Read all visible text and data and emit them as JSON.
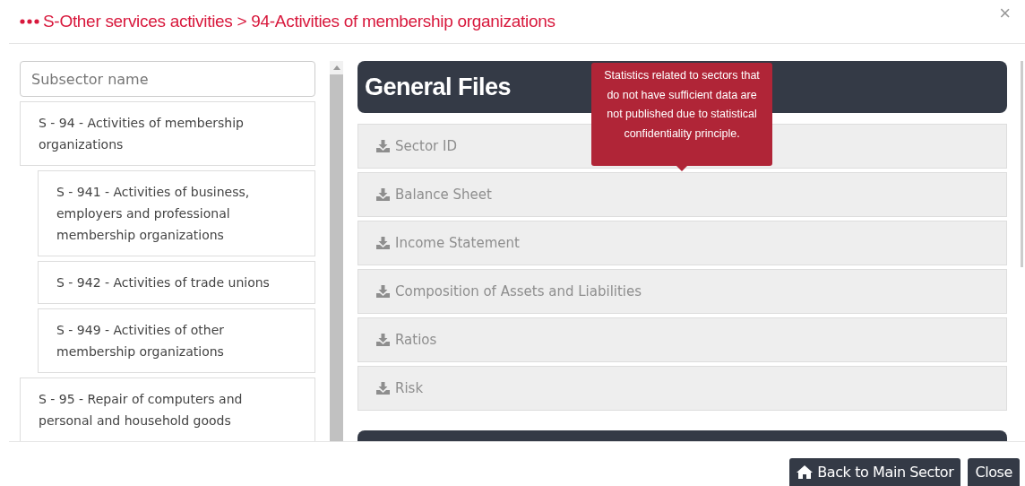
{
  "modal": {
    "title": "S-Other services activities > 94-Activities of membership organizations",
    "close": "×"
  },
  "search": {
    "placeholder": "Subsector name"
  },
  "subsectors": [
    {
      "label": "S - 94 - Activities of membership organizations",
      "children": [
        {
          "label": "S - 941 - Activities of business, employers and professional membership organizations"
        },
        {
          "label": "S - 942 - Activities of trade unions"
        },
        {
          "label": "S - 949 - Activities of other membership organizations"
        }
      ]
    },
    {
      "label": "S - 95 - Repair of computers and personal and household goods"
    }
  ],
  "general_files": {
    "title": "General Files",
    "files": [
      {
        "label": "Sector ID",
        "disabled": true
      },
      {
        "label": "Balance Sheet",
        "disabled": true
      },
      {
        "label": "Income Statement",
        "disabled": true
      },
      {
        "label": "Composition of Assets and Liabilities",
        "disabled": true
      },
      {
        "label": "Ratios",
        "disabled": true
      },
      {
        "label": "Risk",
        "disabled": true
      }
    ]
  },
  "tooltip": "Statistics related to sectors that do not have sufficient data are not published due to statistical confidentiality principle.",
  "buttons": [
    {
      "label": "Back to Main Sector",
      "kind": "home"
    },
    {
      "label": "Close",
      "kind": "plain"
    }
  ]
}
